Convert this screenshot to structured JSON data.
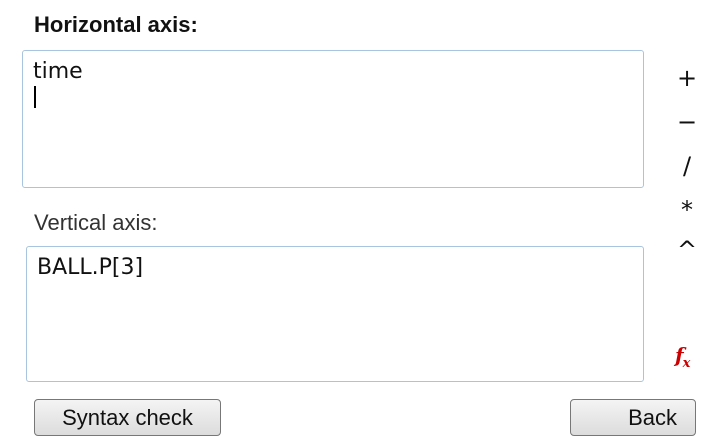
{
  "horizontal_axis": {
    "label": "Horizontal axis:",
    "value": "time"
  },
  "vertical_axis": {
    "label": "Vertical axis:",
    "value": "BALL.P[3]"
  },
  "operators": [
    {
      "symbol": "+",
      "name": "plus"
    },
    {
      "symbol": "−",
      "name": "minus"
    },
    {
      "symbol": "/",
      "name": "divide"
    },
    {
      "symbol": "*",
      "name": "multiply"
    },
    {
      "symbol": "^",
      "name": "power"
    }
  ],
  "function_button": {
    "main": "f",
    "sub": "x",
    "icon": "function-icon",
    "color": "#cc0000"
  },
  "buttons": {
    "syntax_check": "Syntax check",
    "back": "Back"
  },
  "colors": {
    "field_border": "#a9c4de",
    "button_border": "#777777"
  }
}
